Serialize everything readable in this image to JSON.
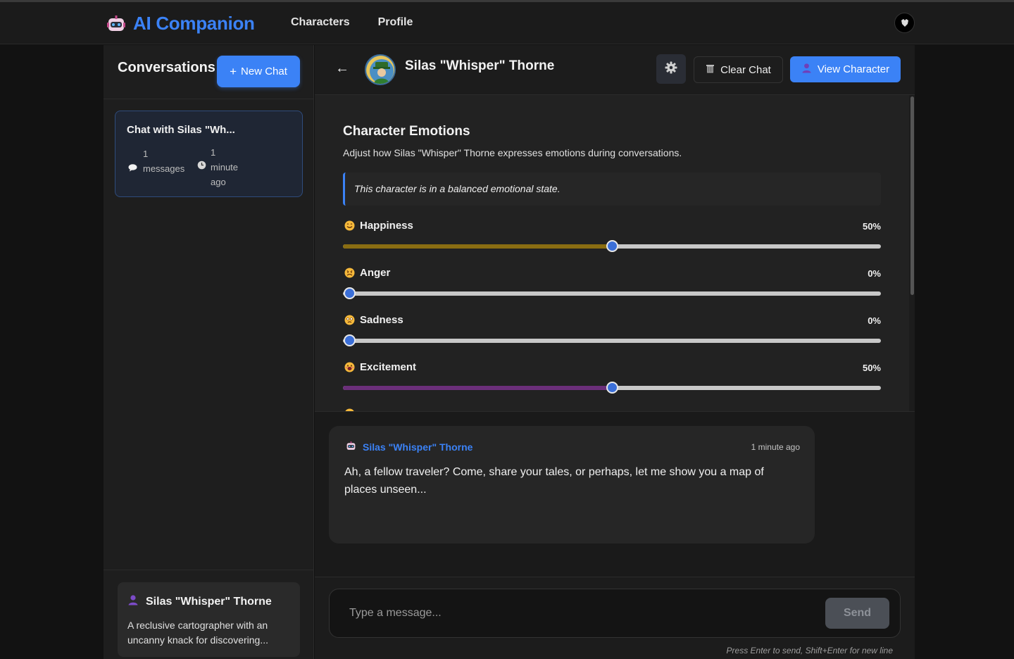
{
  "header": {
    "app_title": "AI Companion",
    "nav": [
      "Characters",
      "Profile"
    ],
    "logo_icon": "robot-icon",
    "user_avatar_icon": "user-avatar"
  },
  "sidebar": {
    "title": "Conversations",
    "new_chat_label": "New Chat",
    "new_chat_prefix": "+",
    "conversations": [
      {
        "title": "Chat with Silas \"Wh...",
        "message_count": "1",
        "message_label": "messages",
        "time_value": "1",
        "time_label": "minute",
        "time_suffix": "ago"
      }
    ],
    "character": {
      "name": "Silas \"Whisper\" Thorne",
      "description": "A reclusive cartographer with an uncanny knack for discovering..."
    }
  },
  "chat": {
    "back_symbol": "←",
    "title": "Silas \"Whisper\" Thorne",
    "clear_label": "Clear Chat",
    "view_label": "View Character"
  },
  "emotions": {
    "title": "Character Emotions",
    "subtitle": "Adjust how Silas \"Whisper\" Thorne expresses emotions during conversations.",
    "state": "This character is in a balanced emotional state.",
    "items": [
      {
        "label": "Happiness",
        "value_text": "50%",
        "value": 0.5,
        "color": "#8a6d12"
      },
      {
        "label": "Anger",
        "value_text": "0%",
        "value": 0.0,
        "color": "#c0392b"
      },
      {
        "label": "Sadness",
        "value_text": "0%",
        "value": 0.0,
        "color": "#2980b9"
      },
      {
        "label": "Excitement",
        "value_text": "50%",
        "value": 0.5,
        "color": "#6b2f7a"
      }
    ]
  },
  "messages": [
    {
      "author": "Silas \"Whisper\" Thorne",
      "time": "1 minute ago",
      "text": "Ah, a fellow traveler? Come, share your tales, or perhaps, let me show you a map of places unseen..."
    }
  ],
  "composer": {
    "placeholder": "Type a message...",
    "send_label": "Send",
    "hint": "Press Enter to send, Shift+Enter for new line"
  },
  "colors": {
    "accent": "#3b82f6",
    "background": "#121212"
  }
}
